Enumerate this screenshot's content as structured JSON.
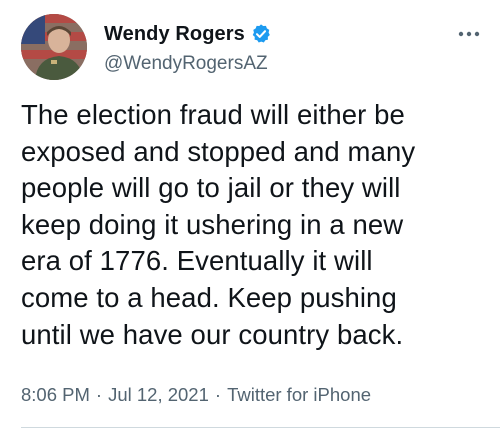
{
  "user": {
    "display_name": "Wendy Rogers",
    "handle": "@WendyRogersAZ",
    "verified": true,
    "verified_color": "#1d9bf0"
  },
  "tweet": {
    "text": "The election fraud will either be\nexposed and stopped and many\npeople will go to jail or they will\nkeep doing it ushering in a new\nera of 1776. Eventually it will\ncome to a head. Keep pushing\nuntil we have our country back.",
    "time": "8:06 PM",
    "date": "Jul 12, 2021",
    "source": "Twitter for iPhone",
    "separator": "·"
  },
  "icons": {
    "more": "more-options-icon",
    "verified": "verified-badge-icon"
  }
}
